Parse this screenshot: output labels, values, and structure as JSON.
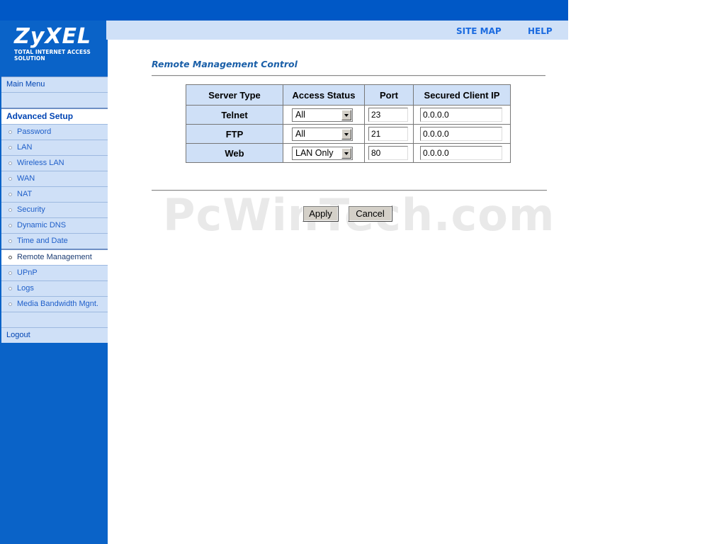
{
  "brand": {
    "name": "ZyXEL",
    "tagline": "Total Internet Access Solution",
    "color": "#0a63c8"
  },
  "header": {
    "links": [
      "SITE MAP",
      "HELP"
    ]
  },
  "sidebar": {
    "main_menu": "Main Menu",
    "section": "Advanced Setup",
    "items": [
      {
        "label": "Password"
      },
      {
        "label": "LAN"
      },
      {
        "label": "Wireless LAN"
      },
      {
        "label": "WAN"
      },
      {
        "label": "NAT"
      },
      {
        "label": "Security"
      },
      {
        "label": "Dynamic DNS"
      },
      {
        "label": "Time and Date"
      },
      {
        "label": "Remote Management",
        "active": true
      },
      {
        "label": "UPnP"
      },
      {
        "label": "Logs"
      },
      {
        "label": "Media Bandwidth Mgnt."
      }
    ],
    "logout": "Logout"
  },
  "main": {
    "title": "Remote Management Control",
    "table": {
      "headers": [
        "Server Type",
        "Access Status",
        "Port",
        "Secured Client IP"
      ],
      "rows": [
        {
          "server": "Telnet",
          "access": "All",
          "port": "23",
          "ip": "0.0.0.0"
        },
        {
          "server": "FTP",
          "access": "All",
          "port": "21",
          "ip": "0.0.0.0"
        },
        {
          "server": "Web",
          "access": "LAN Only",
          "port": "80",
          "ip": "0.0.0.0"
        }
      ]
    },
    "buttons": {
      "apply": "Apply",
      "cancel": "Cancel"
    },
    "watermark": "PcWinTech.com"
  }
}
